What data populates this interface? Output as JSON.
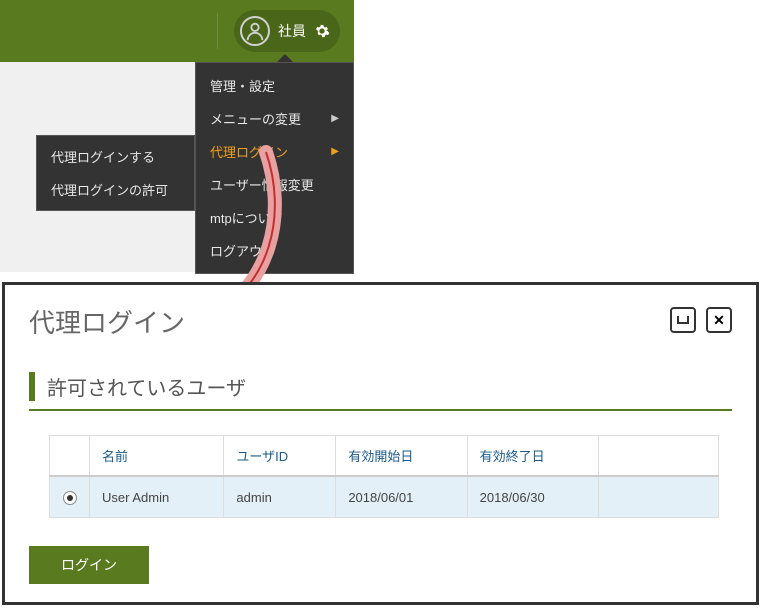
{
  "header": {
    "user_label": "社員"
  },
  "dropdown": {
    "items": [
      {
        "label": "管理・設定",
        "has_arrow": false
      },
      {
        "label": "メニューの変更",
        "has_arrow": true
      },
      {
        "label": "代理ログイン",
        "has_arrow": true,
        "active": true
      },
      {
        "label": "ユーザー情報変更",
        "has_arrow": false
      },
      {
        "label": "mtpについて",
        "has_arrow": false
      },
      {
        "label": "ログアウト",
        "has_arrow": false
      }
    ]
  },
  "submenu": {
    "items": [
      {
        "label": "代理ログインする"
      },
      {
        "label": "代理ログインの許可"
      }
    ]
  },
  "window": {
    "title": "代理ログイン",
    "section_title": "許可されているユーザ",
    "table": {
      "headers": [
        "",
        "名前",
        "ユーザID",
        "有効開始日",
        "有効終了日",
        ""
      ],
      "rows": [
        {
          "selected": true,
          "name": "User Admin",
          "user_id": "admin",
          "start": "2018/06/01",
          "end": "2018/06/30"
        }
      ]
    },
    "login_button": "ログイン"
  }
}
